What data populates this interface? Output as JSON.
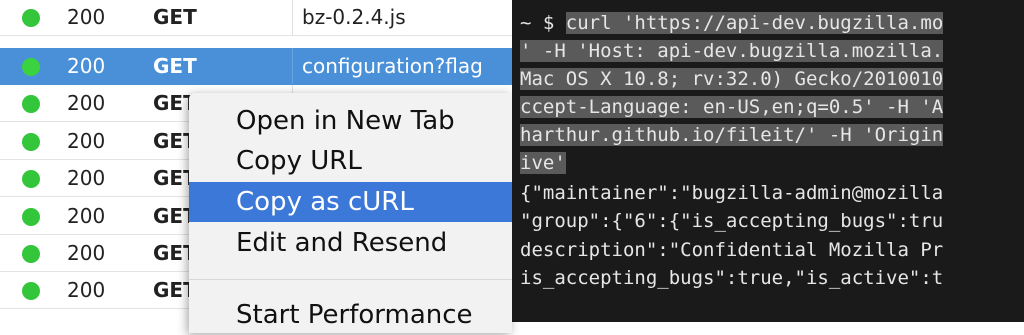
{
  "network": {
    "rows": [
      {
        "status": "200",
        "method": "GET",
        "file": "bz-0.2.4.js",
        "selected": false
      },
      {
        "status": "200",
        "method": "GET",
        "file": "configuration?flag",
        "selected": true
      },
      {
        "status": "200",
        "method": "GET",
        "file": "",
        "selected": false
      },
      {
        "status": "200",
        "method": "GET",
        "file": "",
        "selected": false
      },
      {
        "status": "200",
        "method": "GET",
        "file": "",
        "selected": false
      },
      {
        "status": "200",
        "method": "GET",
        "file": "",
        "selected": false
      },
      {
        "status": "200",
        "method": "GET",
        "file": "",
        "selected": false
      },
      {
        "status": "200",
        "method": "GET",
        "file": "",
        "selected": false
      }
    ]
  },
  "context_menu": {
    "items": [
      {
        "label": "Open in New Tab",
        "highlighted": false
      },
      {
        "label": "Copy URL",
        "highlighted": false
      },
      {
        "label": "Copy as cURL",
        "highlighted": true
      },
      {
        "label": "Edit and Resend",
        "highlighted": false
      },
      {
        "label": "Start Performance",
        "highlighted": false
      }
    ]
  },
  "terminal": {
    "lines": [
      {
        "parts": [
          {
            "text": "~ $ ",
            "sel": false
          },
          {
            "text": "curl 'https://api-dev.bugzilla.mo",
            "sel": true
          }
        ]
      },
      {
        "parts": [
          {
            "text": "' -H 'Host: api-dev.bugzilla.mozilla.",
            "sel": true
          }
        ]
      },
      {
        "parts": [
          {
            "text": "Mac OS X 10.8; rv:32.0) Gecko/2010010",
            "sel": true
          }
        ]
      },
      {
        "parts": [
          {
            "text": "ccept-Language: en-US,en;q=0.5' -H 'A",
            "sel": true
          }
        ]
      },
      {
        "parts": [
          {
            "text": "harthur.github.io/fileit/' -H 'Origin",
            "sel": true
          }
        ]
      },
      {
        "parts": [
          {
            "text": "ive'",
            "sel": true
          }
        ]
      },
      {
        "parts": [
          {
            "text": "{\"maintainer\":\"bugzilla-admin@mozilla",
            "sel": false
          }
        ]
      },
      {
        "parts": [
          {
            "text": "\"group\":{\"6\":{\"is_accepting_bugs\":tru",
            "sel": false
          }
        ]
      },
      {
        "parts": [
          {
            "text": "description\":\"Confidential Mozilla Pr",
            "sel": false
          }
        ]
      },
      {
        "parts": [
          {
            "text": "is_accepting_bugs\":true,\"is_active\":t",
            "sel": false
          }
        ]
      }
    ]
  },
  "colors": {
    "status_ok": "#34c63a",
    "row_selected": "#4a90d9",
    "menu_highlight": "#3b78d8",
    "terminal_bg": "#1a1a1a"
  }
}
